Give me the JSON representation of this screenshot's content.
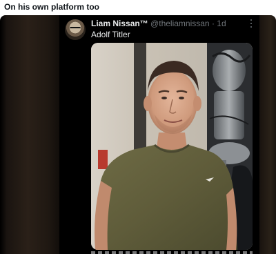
{
  "post": {
    "caption": "On his own platform too"
  },
  "tweet": {
    "display_name": "Liam Nissan™",
    "handle": "@theliamnissan",
    "separator": "·",
    "time": "1d",
    "text": "Adolf Titler",
    "media_alt": "photo",
    "more_icon": "ellipsis-vertical-icon"
  },
  "colors": {
    "tweet_bg": "#000000",
    "name_color": "#e7e9ea",
    "meta_color": "#71767b"
  }
}
